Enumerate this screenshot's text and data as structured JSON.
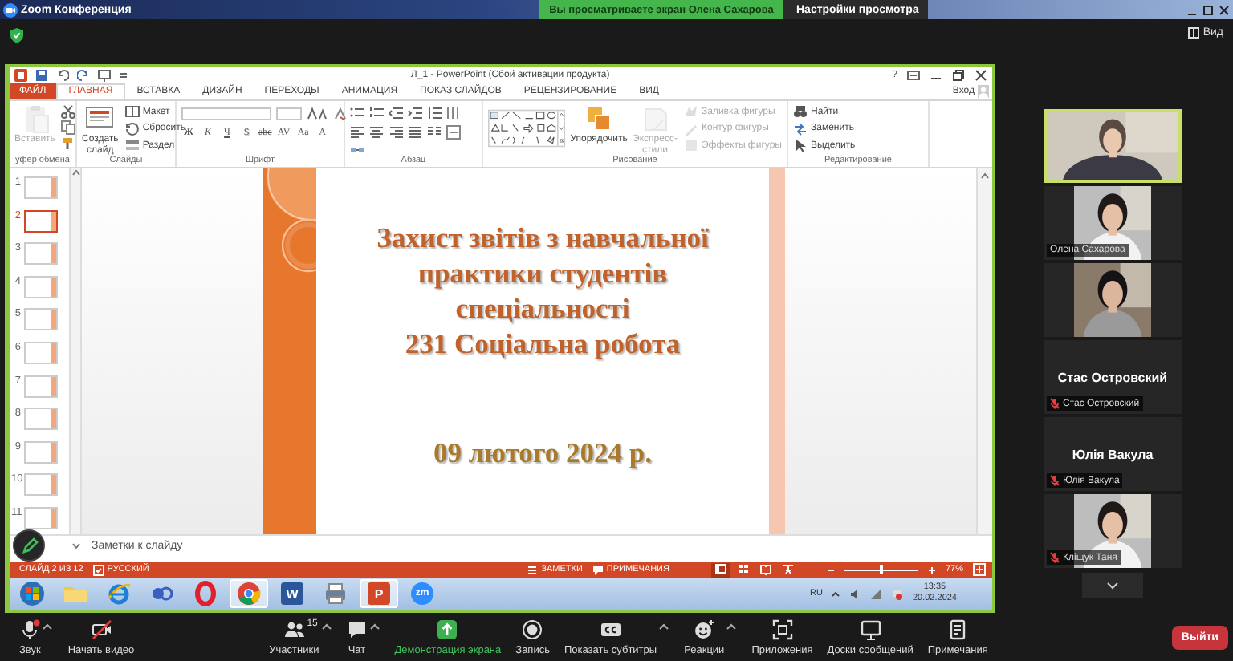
{
  "zoom": {
    "title": "Zoom Конференция",
    "share_banner": "Вы просматриваете экран Олена Сахарова",
    "view_options": "Настройки просмотра",
    "view_button": "Вид"
  },
  "powerpoint": {
    "title": "Л_1 - PowerPoint (Сбой активации продукта)",
    "help": "?",
    "tabs": [
      {
        "label": "ФАЙЛ",
        "kind": "file",
        "selected": false
      },
      {
        "label": "ГЛАВНАЯ",
        "kind": "tab",
        "selected": true
      },
      {
        "label": "ВСТАВКА",
        "kind": "tab",
        "selected": false
      },
      {
        "label": "ДИЗАЙН",
        "kind": "tab",
        "selected": false
      },
      {
        "label": "ПЕРЕХОДЫ",
        "kind": "tab",
        "selected": false
      },
      {
        "label": "АНИМАЦИЯ",
        "kind": "tab",
        "selected": false
      },
      {
        "label": "ПОКАЗ СЛАЙДОВ",
        "kind": "tab",
        "selected": false
      },
      {
        "label": "РЕЦЕНЗИРОВАНИЕ",
        "kind": "tab",
        "selected": false
      },
      {
        "label": "ВИД",
        "kind": "tab",
        "selected": false
      }
    ],
    "sign_in": "Вход",
    "ribbon": [
      {
        "kind": "clipboard",
        "label": "уфер обмена",
        "buttons": [
          {
            "label": "Вставить",
            "kind": "large",
            "disabled": true
          }
        ]
      },
      {
        "kind": "slides",
        "label": "Слайды",
        "buttons": [
          {
            "label": "Создать слайд",
            "kind": "large",
            "disabled": false
          },
          {
            "label": "Макет",
            "kind": "small",
            "disabled": false
          },
          {
            "label": "Сбросить",
            "kind": "small",
            "disabled": false
          },
          {
            "label": "Раздел",
            "kind": "small",
            "disabled": false
          }
        ]
      },
      {
        "kind": "font",
        "label": "Шрифт",
        "buttons": [
          {
            "label": "Ж"
          },
          {
            "label": "К"
          },
          {
            "label": "Ч"
          },
          {
            "label": "S"
          },
          {
            "label": "abc"
          },
          {
            "label": "AV"
          },
          {
            "label": "Aa"
          },
          {
            "label": "A"
          }
        ]
      },
      {
        "kind": "paragraph",
        "label": "Абзац"
      },
      {
        "kind": "drawing",
        "label": "Рисование",
        "buttons": [
          {
            "label": "Упорядочить",
            "kind": "large",
            "disabled": false
          },
          {
            "label": "Экспресс-стили",
            "kind": "large",
            "disabled": true
          },
          {
            "label": "Заливка фигуры",
            "kind": "small",
            "disabled": true
          },
          {
            "label": "Контур фигуры",
            "kind": "small",
            "disabled": true
          },
          {
            "label": "Эффекты фигуры",
            "kind": "small",
            "disabled": true
          }
        ]
      },
      {
        "kind": "editing",
        "label": "Редактирование",
        "buttons": [
          {
            "label": "Найти",
            "kind": "small",
            "disabled": false
          },
          {
            "label": "Заменить",
            "kind": "small",
            "disabled": false
          },
          {
            "label": "Выделить",
            "kind": "small",
            "disabled": false
          }
        ]
      }
    ],
    "thumbnails": [
      {
        "number": "1",
        "selected": false
      },
      {
        "number": "2",
        "selected": true
      },
      {
        "number": "3",
        "selected": false
      },
      {
        "number": "4",
        "selected": false
      },
      {
        "number": "5",
        "selected": false
      },
      {
        "number": "6",
        "selected": false
      },
      {
        "number": "7",
        "selected": false
      },
      {
        "number": "8",
        "selected": false
      },
      {
        "number": "9",
        "selected": false
      },
      {
        "number": "10",
        "selected": false
      },
      {
        "number": "11",
        "selected": false
      }
    ],
    "slide": {
      "title": "Захист звітів з навчальної\nпрактики студентів\nспеціальності\n231 Соціальна робота",
      "date": "09 лютого 2024 р."
    },
    "notes_placeholder": "Заметки к слайду",
    "status": {
      "slide": "СЛАЙД 2 ИЗ 12",
      "language": "РУССКИЙ",
      "notes": "ЗАМЕТКИ",
      "comments": "ПРИМЕЧАНИЯ",
      "views": [
        {
          "kind": "normal",
          "selected": true
        },
        {
          "kind": "sorter",
          "selected": false
        },
        {
          "kind": "reading",
          "selected": false
        },
        {
          "kind": "show",
          "selected": false
        }
      ],
      "zoom": {
        "level": 0.5,
        "reading": "77%"
      }
    },
    "taskbar": {
      "apps": [
        {
          "kind": "start",
          "active": false
        },
        {
          "kind": "explorer",
          "active": false
        },
        {
          "kind": "ie",
          "active": false
        },
        {
          "kind": "app",
          "active": false
        },
        {
          "kind": "opera",
          "active": false
        },
        {
          "kind": "chrome",
          "active": true
        },
        {
          "kind": "word",
          "label": "W",
          "active": false
        },
        {
          "kind": "printer",
          "active": false
        },
        {
          "kind": "powerpoint",
          "label": "P",
          "active": true
        },
        {
          "kind": "zoom",
          "label": "zm",
          "active": false
        }
      ],
      "language": "RU",
      "time": "13:35",
      "date": "20.02.2024"
    }
  },
  "participants": [
    {
      "kind": "video",
      "speaking": true,
      "muted": false
    },
    {
      "kind": "video",
      "caption": "Олена Сахарова",
      "speaking": false,
      "muted": false
    },
    {
      "kind": "video",
      "speaking": false,
      "muted": false
    },
    {
      "kind": "name",
      "display_name": "Стас Островский",
      "caption": "Стас Островский",
      "speaking": false,
      "muted": true
    },
    {
      "kind": "name",
      "display_name": "Юлія Вакула",
      "caption": "Юлія Вакула",
      "speaking": false,
      "muted": true
    },
    {
      "kind": "video",
      "caption": "Кліщук Таня",
      "speaking": false,
      "muted": true
    }
  ],
  "toolbar": {
    "left": [
      {
        "kind": "mic",
        "label": "Звук",
        "menu": true,
        "alert": true,
        "active": false
      },
      {
        "kind": "video",
        "label": "Начать видео",
        "menu": false,
        "alert": false,
        "active": false
      }
    ],
    "center": [
      {
        "kind": "participants",
        "label": "Участники",
        "count": "15",
        "menu": true,
        "alert": false,
        "active": false
      },
      {
        "kind": "chat",
        "label": "Чат",
        "menu": true,
        "alert": false,
        "active": false
      },
      {
        "kind": "share",
        "label": "Демонстрация экрана",
        "menu": false,
        "alert": false,
        "active": true
      },
      {
        "kind": "record",
        "label": "Запись",
        "menu": false,
        "alert": false,
        "active": false
      },
      {
        "kind": "captions",
        "label": "Показать субтитры",
        "menu": true,
        "alert": false,
        "active": false
      },
      {
        "kind": "reactions",
        "label": "Реакции",
        "menu": true,
        "alert": false,
        "active": false
      },
      {
        "kind": "apps",
        "label": "Приложения",
        "menu": false,
        "alert": false,
        "active": false
      },
      {
        "kind": "whiteboards",
        "label": "Доски сообщений",
        "menu": false,
        "alert": false,
        "active": false
      },
      {
        "kind": "notes",
        "label": "Примечания",
        "menu": false,
        "alert": false,
        "active": false
      }
    ],
    "leave": "Выйти"
  }
}
